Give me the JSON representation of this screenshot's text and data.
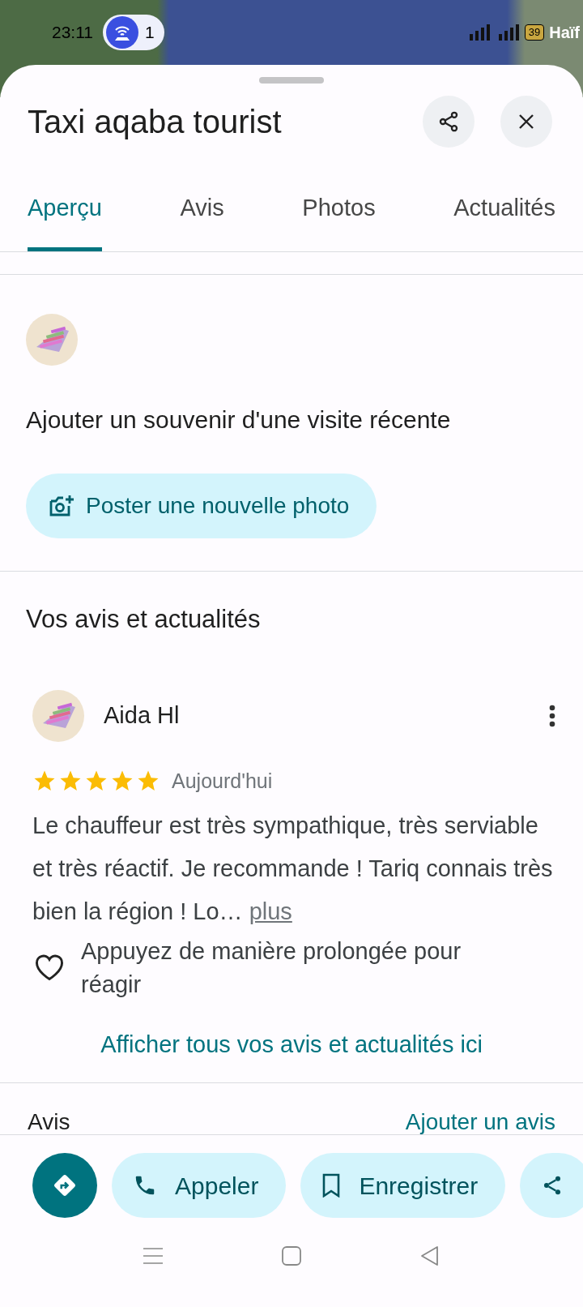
{
  "status_bar": {
    "time": "23:11",
    "notification_count": "1",
    "battery": "39",
    "map_label": "Haïf"
  },
  "place": {
    "title": "Taxi aqaba tourist"
  },
  "tabs": [
    {
      "label": "Aperçu",
      "selected": true
    },
    {
      "label": "Avis",
      "selected": false
    },
    {
      "label": "Photos",
      "selected": false
    },
    {
      "label": "Actualités",
      "selected": false
    }
  ],
  "memory": {
    "heading": "Ajouter un souvenir d'une visite récente",
    "button": "Poster une nouvelle photo"
  },
  "your_reviews": {
    "heading": "Vos avis et actualités",
    "review": {
      "author": "Aida Hl",
      "stars": 5,
      "date": "Aujourd'hui",
      "text": "Le chauffeur est très sympathique, très serviable et très réactif. Je recommande ! Tariq connais très bien la région ! Lo…",
      "more": "plus",
      "react_hint": "Appuyez de manière prolongée pour réagir"
    },
    "show_all": "Afficher tous vos avis et actualités ici"
  },
  "reviews_section": {
    "heading": "Avis",
    "add_link": "Ajouter un avis"
  },
  "actions": [
    {
      "kind": "directions"
    },
    {
      "kind": "call",
      "label": "Appeler"
    },
    {
      "kind": "save",
      "label": "Enregistrer"
    },
    {
      "kind": "share"
    }
  ]
}
